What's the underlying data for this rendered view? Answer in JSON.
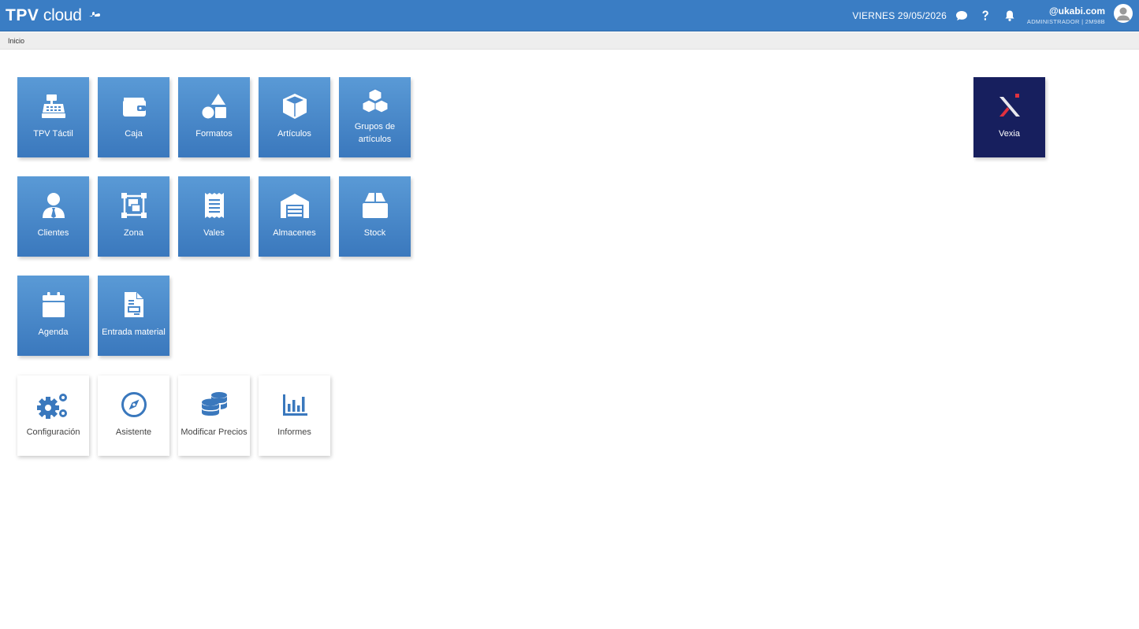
{
  "header": {
    "logo_tpv": "TPV",
    "logo_cloud": "cloud",
    "date": "VIERNES 29/05/2026",
    "user_name": "@ukabi.com",
    "user_role": "ADMINISTRADOR | 2M98B"
  },
  "breadcrumb": "Inicio",
  "tiles": {
    "tpv_tactil": "TPV Táctil",
    "caja": "Caja",
    "formatos": "Formatos",
    "articulos": "Artículos",
    "grupos": "Grupos de artículos",
    "clientes": "Clientes",
    "zona": "Zona",
    "vales": "Vales",
    "almacenes": "Almacenes",
    "stock": "Stock",
    "agenda": "Agenda",
    "entrada_material": "Entrada material",
    "configuracion": "Configuración",
    "asistente": "Asistente",
    "modificar_precios": "Modificar Precios",
    "informes": "Informes",
    "vexia": "Vexia"
  },
  "colors": {
    "header": "#3a7dc4",
    "tile_blue": "#4a89cc",
    "tile_navy": "#171f5e",
    "icon_blue": "#3a78bd",
    "vexia_accent": "#e0313f"
  }
}
